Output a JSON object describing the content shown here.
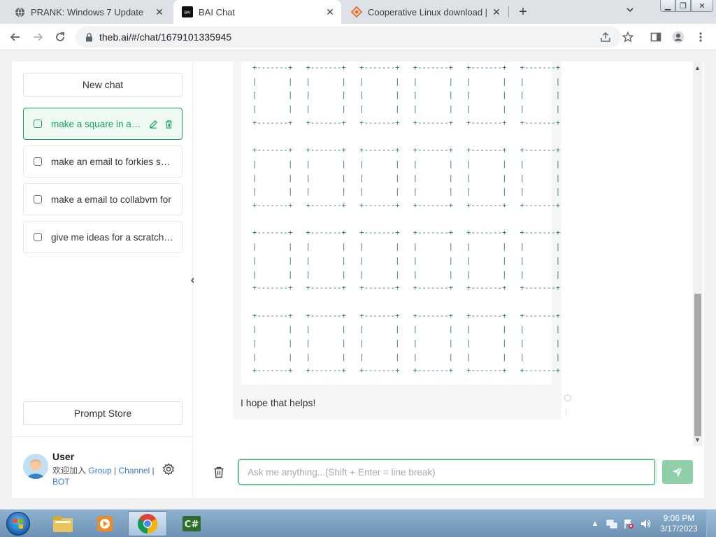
{
  "browser": {
    "tabs": [
      {
        "title": "PRANK: Windows 7 Update",
        "icon": "globe-icon",
        "active": false
      },
      {
        "title": "BAI Chat",
        "icon": "bai-logo-icon",
        "active": true
      },
      {
        "title": "Cooperative Linux download | So",
        "icon": "sourceforge-icon",
        "active": false
      }
    ],
    "url": "theb.ai/#/chat/1679101335945",
    "favicon_bai_text": "BAI"
  },
  "sidebar": {
    "new_chat_label": "New chat",
    "chats": [
      {
        "label": "make a square in ascii",
        "active": true
      },
      {
        "label": "make an email to forkies saying",
        "active": false
      },
      {
        "label": "make a email to collabvm for",
        "active": false
      },
      {
        "label": "give me ideas for a scratch game",
        "active": false
      }
    ],
    "prompt_store_label": "Prompt Store",
    "user": {
      "name": "User",
      "join_text": "欢迎加入",
      "link_group": "Group",
      "sep1": " | ",
      "link_channel": "Channel",
      "sep2": " |",
      "link_bot": "BOT"
    }
  },
  "chat": {
    "ascii_block": "+-------+   +-------+   +-------+   +-------+   +-------+   +-------+\n|       |   |       |   |       |   |       |   |       |   |       |\n|       |   |       |   |       |   |       |   |       |   |       |\n|       |   |       |   |       |   |       |   |       |   |       |\n+-------+   +-------+   +-------+   +-------+   +-------+   +-------+\n\n+-------+   +-------+   +-------+   +-------+   +-------+   +-------+\n|       |   |       |   |       |   |       |   |       |   |       |\n|       |   |       |   |       |   |       |   |       |   |       |\n|       |   |       |   |       |   |       |   |       |   |       |\n+-------+   +-------+   +-------+   +-------+   +-------+   +-------+\n\n+-------+   +-------+   +-------+   +-------+   +-------+   +-------+\n|       |   |       |   |       |   |       |   |       |   |       |\n|       |   |       |   |       |   |       |   |       |   |       |\n|       |   |       |   |       |   |       |   |       |   |       |\n+-------+   +-------+   +-------+   +-------+   +-------+   +-------+\n\n+-------+   +-------+   +-------+   +-------+   +-------+   +-------+\n|       |   |       |   |       |   |       |   |       |   |       |\n|       |   |       |   |       |   |       |   |       |   |       |\n|       |   |       |   |       |   |       |   |       |   |       |\n+-------+   +-------+   +-------+   +-------+   +-------+   +-------+",
    "closing_text": "I hope that helps!",
    "input_placeholder": "Ask me anything...(Shift + Enter = line break)",
    "input_value": ""
  },
  "taskbar": {
    "apps": [
      "explorer",
      "media-player",
      "chrome",
      "csharp-editor"
    ],
    "active_app": "chrome",
    "time": "9:06 PM",
    "date": "3/17/2023"
  },
  "colors": {
    "accent": "#18a058",
    "send_button": "#8fd0a9",
    "tabstrip": "#dee1e6"
  }
}
